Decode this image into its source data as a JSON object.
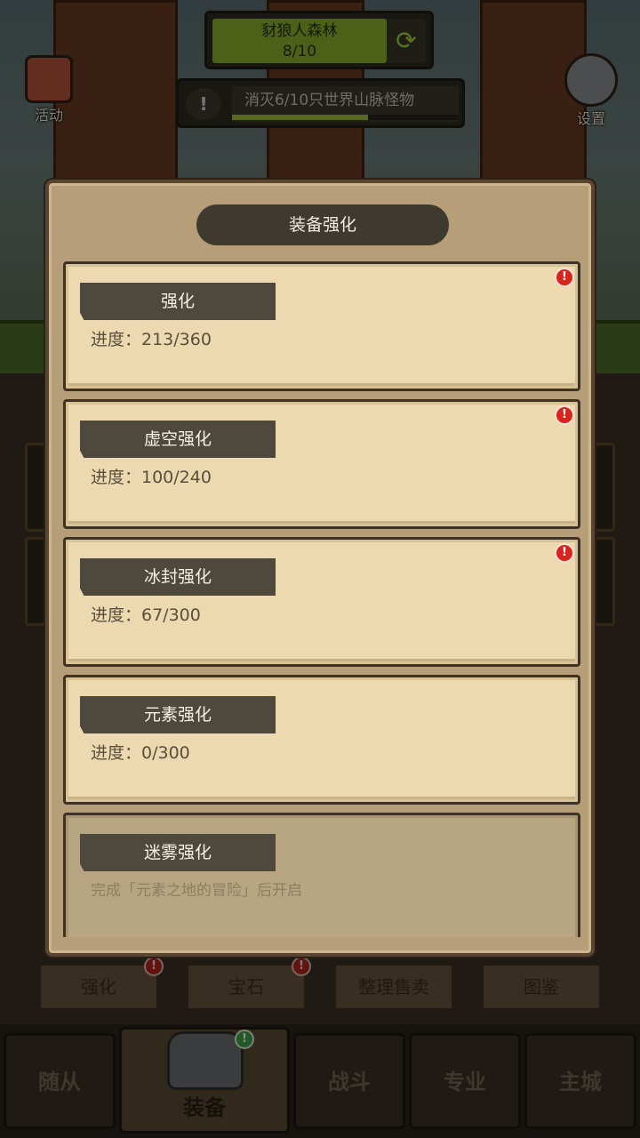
{
  "hud": {
    "zone_name": "豺狼人森林",
    "zone_progress": "8/10",
    "quest_text": "消灭6/10只世界山脉怪物",
    "quest_fill_percent": 60,
    "left_buttons": [
      {
        "label": "活动"
      }
    ],
    "right_buttons": [
      {
        "label": "设置"
      }
    ]
  },
  "modal": {
    "title": "装备强化",
    "progress_prefix": "进度：",
    "cards": [
      {
        "label": "强化",
        "progress": "进度：213/360",
        "alert": true,
        "locked": false
      },
      {
        "label": "虚空强化",
        "progress": "进度：100/240",
        "alert": true,
        "locked": false
      },
      {
        "label": "冰封强化",
        "progress": "进度：67/300",
        "alert": true,
        "locked": false
      },
      {
        "label": "元素强化",
        "progress": "进度：0/300",
        "alert": false,
        "locked": false
      },
      {
        "label": "迷雾强化",
        "progress": "完成「元素之地的冒险」后开启",
        "alert": false,
        "locked": true
      }
    ]
  },
  "subtabs": [
    {
      "label": "强化",
      "alert": true
    },
    {
      "label": "宝石",
      "alert": true
    },
    {
      "label": "整理售卖",
      "alert": false
    },
    {
      "label": "图鉴",
      "alert": false
    }
  ],
  "nav": [
    {
      "label": "随从"
    },
    {
      "label": "装备"
    },
    {
      "label": "战斗"
    },
    {
      "label": "专业"
    },
    {
      "label": "主城"
    }
  ],
  "alert_glyph": "!",
  "colors": {
    "card_bg": "#ecd9b0",
    "label_bg": "#4f483c",
    "alert_red": "#d8241d",
    "zone_green": "#8cb02c"
  }
}
